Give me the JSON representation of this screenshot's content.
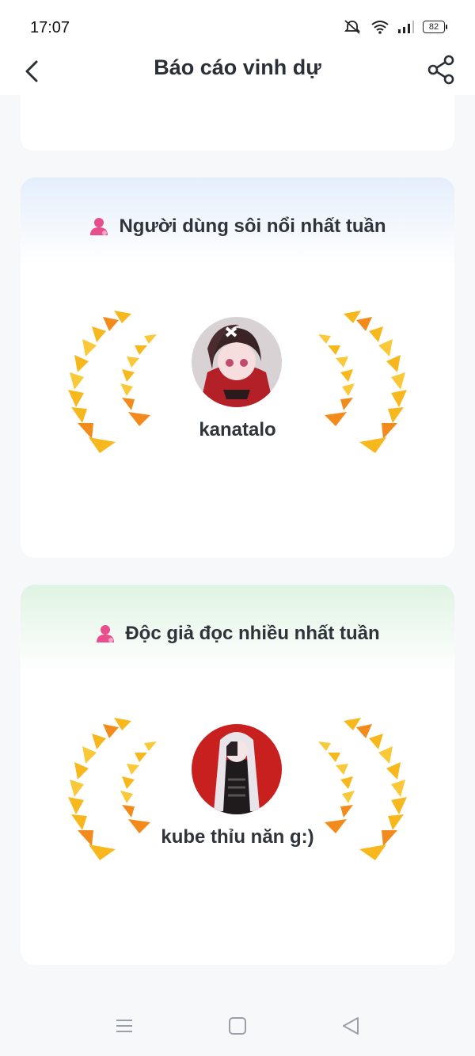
{
  "status_bar": {
    "time": "17:07",
    "battery": "82"
  },
  "header": {
    "title": "Báo cáo vinh dự"
  },
  "cards": [
    {
      "title": "Người dùng sôi nổi nhất tuần",
      "username": "kanatalo"
    },
    {
      "title": "Độc giả đọc nhiều nhất tuần",
      "username": "kube thỉu năn g:)"
    }
  ],
  "colors": {
    "accent_pink": "#e94e8c",
    "wreath_gold": "#f7b81e",
    "wreath_orange": "#f28a1c",
    "card_blue": "#e4eefb",
    "card_green": "#dff3e3"
  },
  "icons": [
    "back-icon",
    "share-icon",
    "user-icon",
    "laurel-wreath-icon",
    "menu-icon",
    "home-icon",
    "back-triangle-icon",
    "mute-icon",
    "wifi-icon",
    "signal-icon",
    "battery-icon"
  ]
}
